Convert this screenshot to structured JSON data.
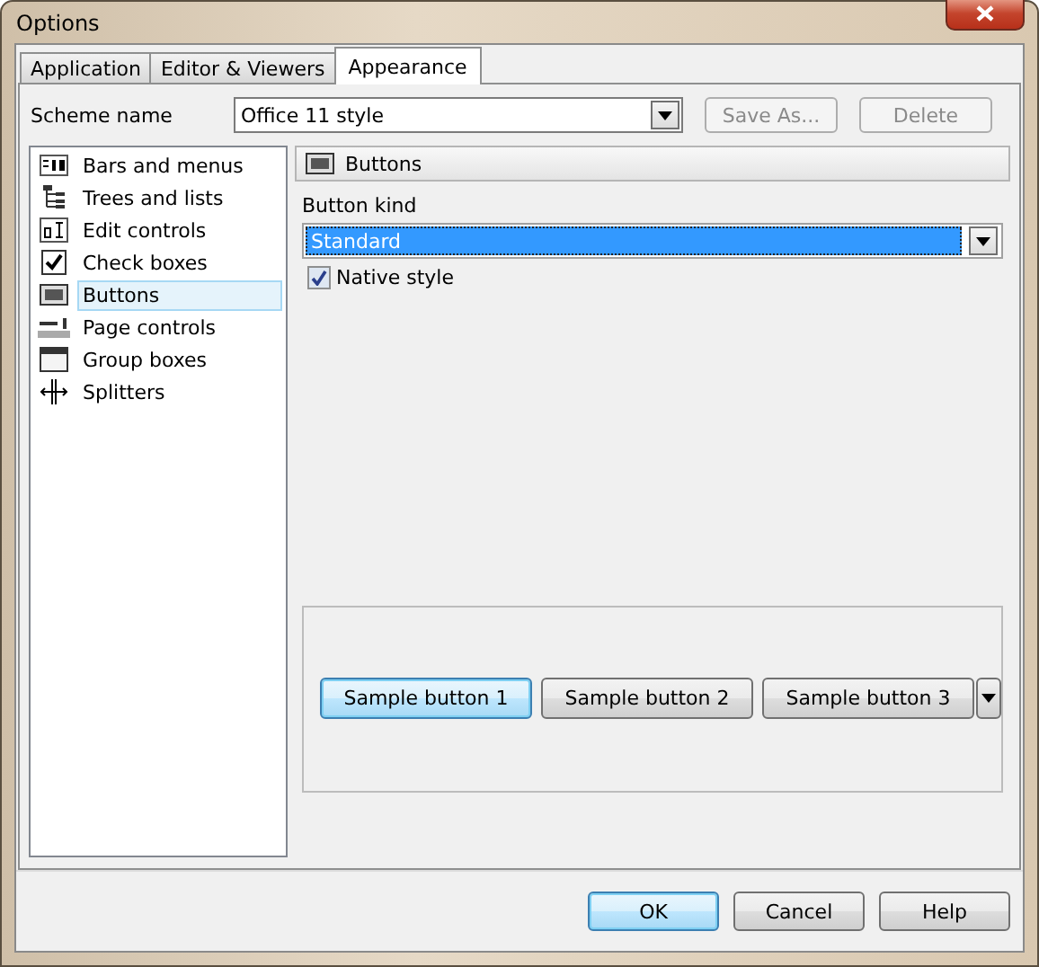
{
  "window": {
    "title": "Options"
  },
  "tabs": [
    {
      "label": "Application",
      "selected": false
    },
    {
      "label": "Editor & Viewers",
      "selected": false
    },
    {
      "label": "Appearance",
      "selected": true
    }
  ],
  "scheme": {
    "label": "Scheme name",
    "value": "Office 11 style",
    "buttons": [
      {
        "label": "Save As...",
        "disabled": true
      },
      {
        "label": "Delete",
        "disabled": true
      }
    ]
  },
  "categories": [
    {
      "label": "Bars and menus",
      "kind": "bars",
      "selected": false
    },
    {
      "label": "Trees and lists",
      "kind": "tree",
      "selected": false
    },
    {
      "label": "Edit controls",
      "kind": "edit",
      "selected": false
    },
    {
      "label": "Check boxes",
      "kind": "check",
      "selected": false
    },
    {
      "label": "Buttons",
      "kind": "button",
      "selected": true
    },
    {
      "label": "Page controls",
      "kind": "page",
      "selected": false
    },
    {
      "label": "Group boxes",
      "kind": "group",
      "selected": false
    },
    {
      "label": "Splitters",
      "kind": "splitter",
      "selected": false
    }
  ],
  "panel": {
    "title": "Buttons",
    "button_kind_label": "Button kind",
    "button_kind_value": "Standard",
    "native_style": {
      "label": "Native style",
      "checked": true
    }
  },
  "samples": [
    {
      "label": "Sample button 1",
      "focused": true,
      "dropdown": false
    },
    {
      "label": "Sample button 2",
      "focused": false,
      "dropdown": false
    },
    {
      "label": "Sample button 3",
      "focused": false,
      "dropdown": true
    }
  ],
  "footer_buttons": [
    {
      "label": "OK",
      "default": true
    },
    {
      "label": "Cancel",
      "default": false
    },
    {
      "label": "Help",
      "default": false
    }
  ]
}
